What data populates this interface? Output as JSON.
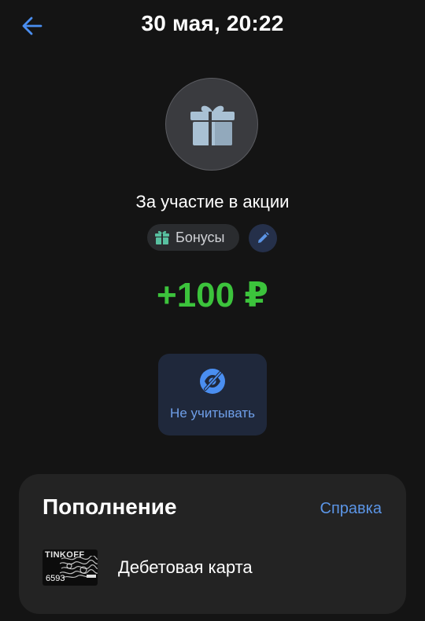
{
  "header": {
    "title": "30 мая, 20:22",
    "back_icon": "arrow-left-icon"
  },
  "operation": {
    "icon": "gift-icon",
    "description": "За участие в акции",
    "category": {
      "label": "Бонусы",
      "icon": "gift-icon"
    },
    "edit_icon": "pencil-icon",
    "amount": "+100 ₽",
    "amount_color": "#3cc33c"
  },
  "actions": {
    "exclude": {
      "label": "Не учитывать",
      "icon": "eye-off-icon"
    }
  },
  "details": {
    "title": "Пополнение",
    "help_label": "Справка",
    "card": {
      "brand": "TINKOFF",
      "last_digits": "6593",
      "name": "Дебетовая карта"
    }
  },
  "colors": {
    "accent": "#5b95e6",
    "background": "#141414",
    "panel": "#232323"
  }
}
